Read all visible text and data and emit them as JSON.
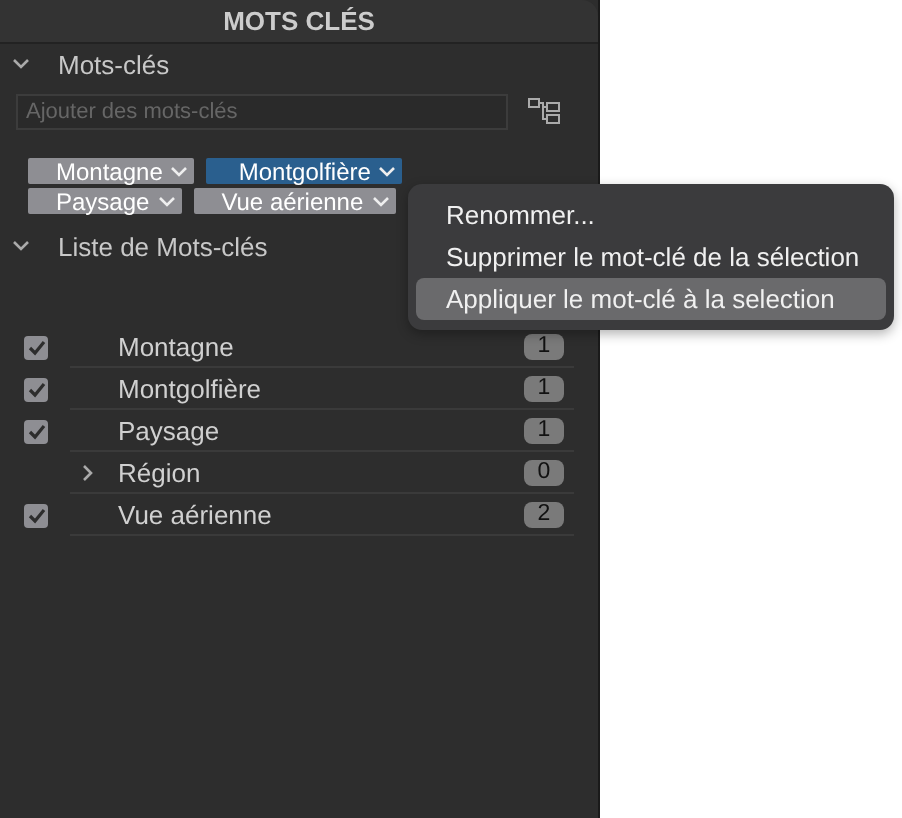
{
  "panel": {
    "title": "MOTS CLÉS"
  },
  "keywords_section": {
    "title": "Mots-clés",
    "expanded": true,
    "field": {
      "placeholder": "Ajouter des mots-clés"
    },
    "tags": [
      {
        "label": "Montagne",
        "selected": false
      },
      {
        "label": "Montgolfière",
        "selected": true
      },
      {
        "label": "Paysage",
        "selected": false
      },
      {
        "label": "Vue aérienne",
        "selected": false
      }
    ]
  },
  "list_section": {
    "title": "Liste de Mots-clés",
    "expanded": true,
    "items": [
      {
        "kind": "keyword",
        "label": "Montagne",
        "checked": true,
        "count": "1"
      },
      {
        "kind": "keyword",
        "label": "Montgolfière",
        "checked": true,
        "count": "1"
      },
      {
        "kind": "keyword",
        "label": "Paysage",
        "checked": true,
        "count": "1"
      },
      {
        "kind": "group",
        "label": "Région",
        "expanded": false,
        "count": "0"
      },
      {
        "kind": "keyword",
        "label": "Vue aérienne",
        "checked": true,
        "count": "2"
      }
    ]
  },
  "context_menu": {
    "items": [
      {
        "label": "Renommer...",
        "selected": false
      },
      {
        "label": "Supprimer le mot-clé de la sélection",
        "selected": false
      },
      {
        "label": "Appliquer le mot-clé à la selection",
        "selected": true
      }
    ]
  }
}
